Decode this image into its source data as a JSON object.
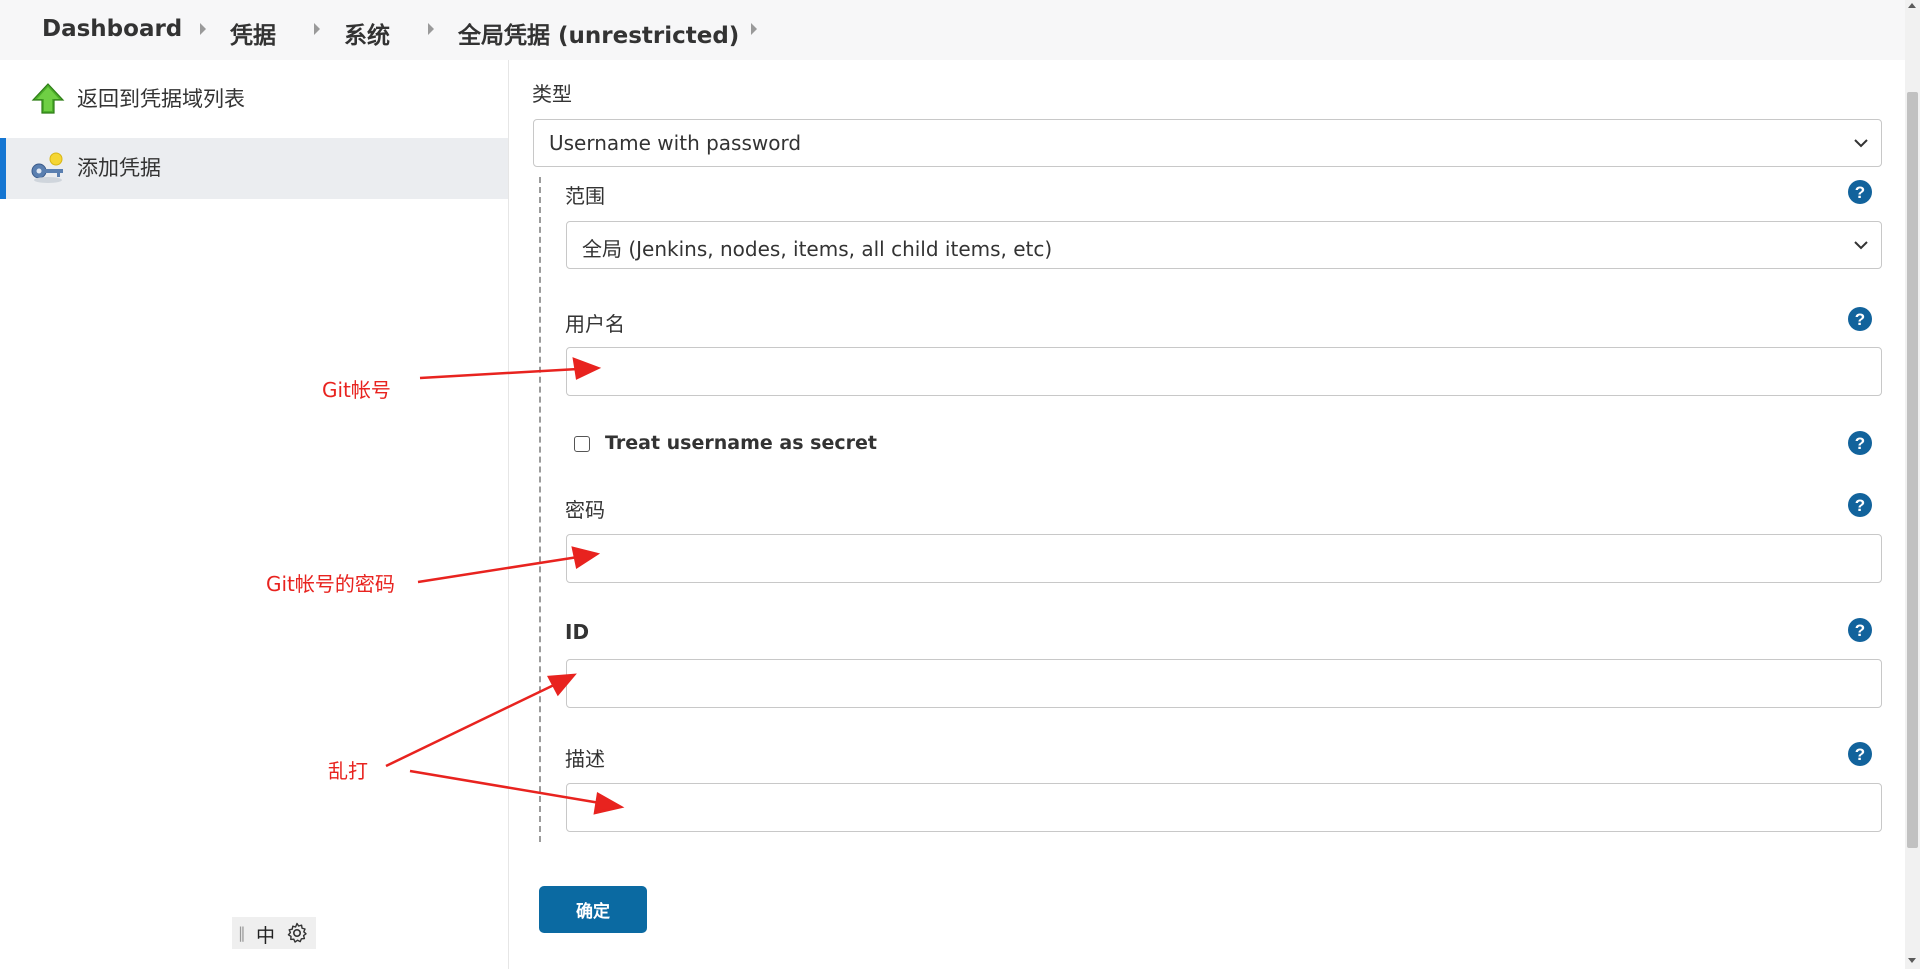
{
  "breadcrumb": {
    "items": [
      "Dashboard",
      "凭据",
      "系统",
      "全局凭据 (unrestricted)"
    ]
  },
  "sidebar": {
    "items": [
      {
        "label": "返回到凭据域列表",
        "icon": "up-arrow-icon"
      },
      {
        "label": "添加凭据",
        "icon": "credentials-key-icon"
      }
    ]
  },
  "language": {
    "label": "中"
  },
  "form": {
    "kind_label": "类型",
    "kind_value": "Username with password",
    "scope_label": "范围",
    "scope_value": "全局 (Jenkins, nodes, items, all child items, etc)",
    "username_label": "用户名",
    "username_value": "",
    "secret_checkbox_label": "Treat username as secret",
    "password_label": "密码",
    "password_value": "",
    "id_label": "ID",
    "id_value": "",
    "description_label": "描述",
    "description_value": "",
    "submit_label": "确定"
  },
  "annotations": {
    "username_note": "Git帐号",
    "password_note": "Git帐号的密码",
    "random_note": "乱打"
  },
  "colors": {
    "accent": "#0b6aa2",
    "annotation": "#e8231f",
    "active_indicator": "#1576d2"
  }
}
